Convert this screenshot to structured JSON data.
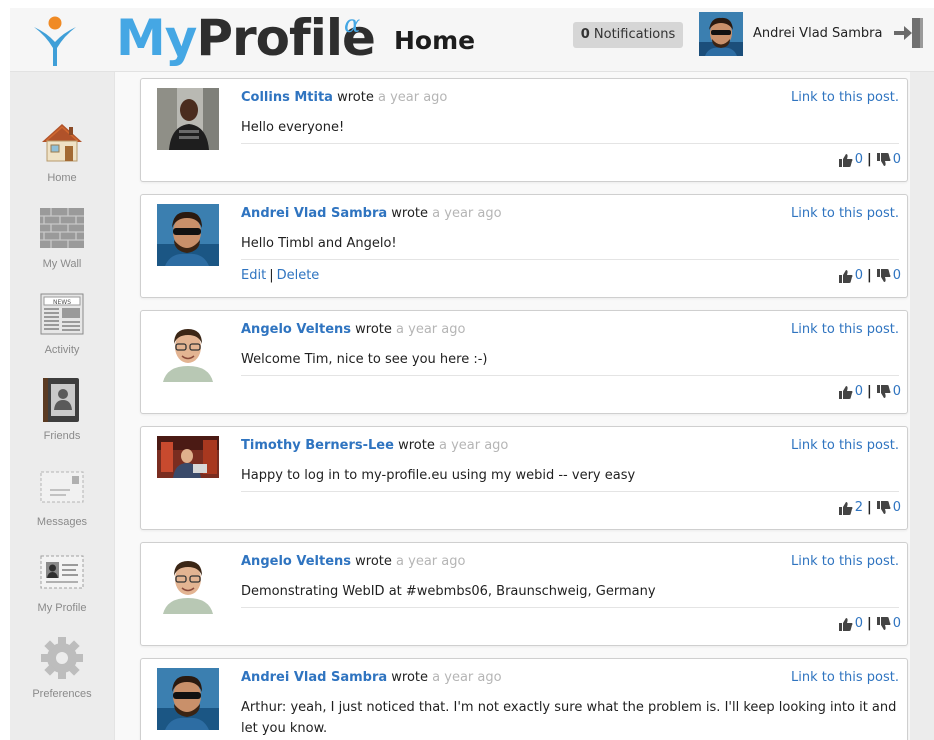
{
  "header": {
    "brand_my": "My",
    "brand_profile": "Profile",
    "brand_alpha": "α",
    "page_title": "Home",
    "notifications_count": "0",
    "notifications_label": "Notifications",
    "user_name": "Andrei Vlad Sambra",
    "icons": [
      "logo-icon",
      "logout-icon"
    ]
  },
  "sidebar": {
    "items": [
      {
        "label": "Home",
        "icon": "home-icon"
      },
      {
        "label": "My Wall",
        "icon": "wall-icon"
      },
      {
        "label": "Activity",
        "icon": "newspaper-icon"
      },
      {
        "label": "Friends",
        "icon": "address-book-icon"
      },
      {
        "label": "Messages",
        "icon": "envelope-icon"
      },
      {
        "label": "My Profile",
        "icon": "id-card-icon"
      },
      {
        "label": "Preferences",
        "icon": "gear-icon"
      }
    ]
  },
  "feed": {
    "posts": [
      {
        "author": "Collins Mtita",
        "verb": "wrote",
        "time": "a year ago",
        "link": "Link to this post.",
        "text": "Hello everyone!",
        "likes": "0",
        "dislikes": "0"
      },
      {
        "author": "Andrei Vlad Sambra",
        "verb": "wrote",
        "time": "a year ago",
        "link": "Link to this post.",
        "text": "Hello Timbl and Angelo!",
        "edit": "Edit",
        "delete": "Delete",
        "likes": "0",
        "dislikes": "0"
      },
      {
        "author": "Angelo Veltens",
        "verb": "wrote",
        "time": "a year ago",
        "link": "Link to this post.",
        "text": "Welcome Tim, nice to see you here :-)",
        "likes": "0",
        "dislikes": "0"
      },
      {
        "author": "Timothy Berners-Lee",
        "verb": "wrote",
        "time": "a year ago",
        "link": "Link to this post.",
        "text": "Happy to log in to my-profile.eu using my webid -- very easy",
        "likes": "2",
        "dislikes": "0"
      },
      {
        "author": "Angelo Veltens",
        "verb": "wrote",
        "time": "a year ago",
        "link": "Link to this post.",
        "text": "Demonstrating WebID at #webmbs06, Braunschweig, Germany",
        "likes": "0",
        "dislikes": "0"
      },
      {
        "author": "Andrei Vlad Sambra",
        "verb": "wrote",
        "time": "a year ago",
        "link": "Link to this post.",
        "text": "Arthur: yeah, I just noticed that. I'm not exactly sure what the problem is. I'll keep looking into it and let you know."
      }
    ]
  },
  "colors": {
    "accent": "#45a7e4",
    "link": "#2f74c0",
    "muted": "#b5b5b5"
  }
}
